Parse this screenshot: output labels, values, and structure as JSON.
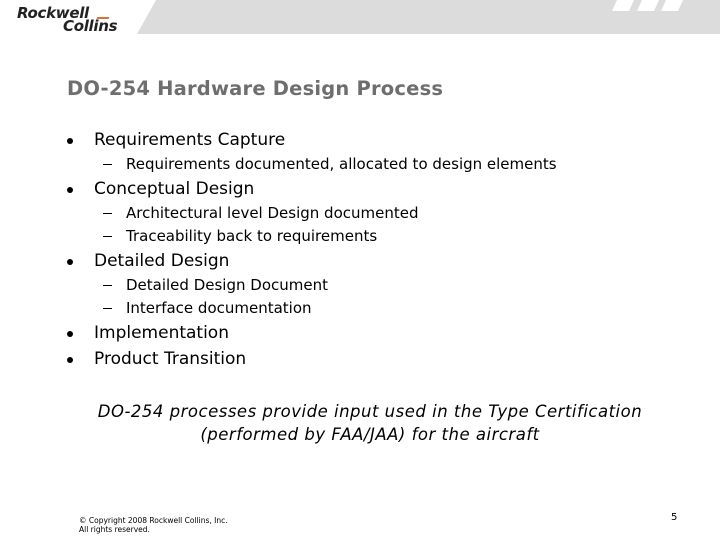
{
  "header": {
    "logo": {
      "line1": "Rockwell",
      "line2": "Collins"
    },
    "band_color": "#dcdcdc",
    "accent_color": "#e0703a"
  },
  "slide": {
    "title": "DO-254 Hardware Design Process",
    "bullets": [
      {
        "label": "Requirements Capture",
        "subitems": [
          "Requirements documented, allocated to design elements"
        ]
      },
      {
        "label": "Conceptual Design",
        "subitems": [
          "Architectural level Design documented",
          "Traceability back to requirements"
        ]
      },
      {
        "label": "Detailed Design",
        "subitems": [
          "Detailed Design Document",
          "Interface documentation"
        ]
      },
      {
        "label": "Implementation",
        "subitems": []
      },
      {
        "label": "Product Transition",
        "subitems": []
      }
    ],
    "note_line1": "DO-254 processes provide input used in the Type Certification",
    "note_line2": "(performed by FAA/JAA) for the aircraft"
  },
  "footer": {
    "copyright_line1": "© Copyright 2008 Rockwell Collins, Inc.",
    "copyright_line2": "All rights reserved.",
    "page_number": "5"
  }
}
